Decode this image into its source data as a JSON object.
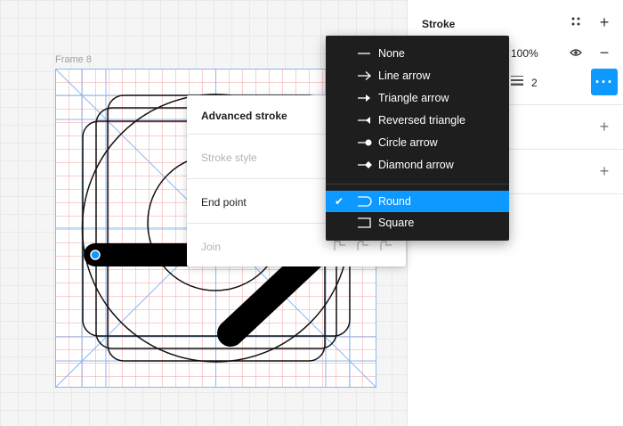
{
  "canvas": {
    "frame_label": "Frame 8"
  },
  "panel": {
    "title": "Stroke",
    "opacity": "100%",
    "weight": "2",
    "more_label": "···"
  },
  "advanced_stroke": {
    "title": "Advanced stroke",
    "stroke_style_label": "Stroke style",
    "end_point_label": "End point",
    "join_label": "Join"
  },
  "menu": {
    "items": [
      {
        "label": "None",
        "icon": "line-none-icon"
      },
      {
        "label": "Line arrow",
        "icon": "line-arrow-icon"
      },
      {
        "label": "Triangle arrow",
        "icon": "triangle-arrow-icon"
      },
      {
        "label": "Reversed triangle",
        "icon": "reversed-triangle-icon"
      },
      {
        "label": "Circle arrow",
        "icon": "circle-arrow-icon"
      },
      {
        "label": "Diamond arrow",
        "icon": "diamond-arrow-icon"
      }
    ],
    "caps": [
      {
        "label": "Round",
        "icon": "round-cap-icon",
        "selected": true
      },
      {
        "label": "Square",
        "icon": "square-cap-icon",
        "selected": false
      }
    ]
  },
  "colors": {
    "accent": "#0d99ff",
    "menu_bg": "#1e1e1e",
    "guide": "#8ab8ee"
  }
}
